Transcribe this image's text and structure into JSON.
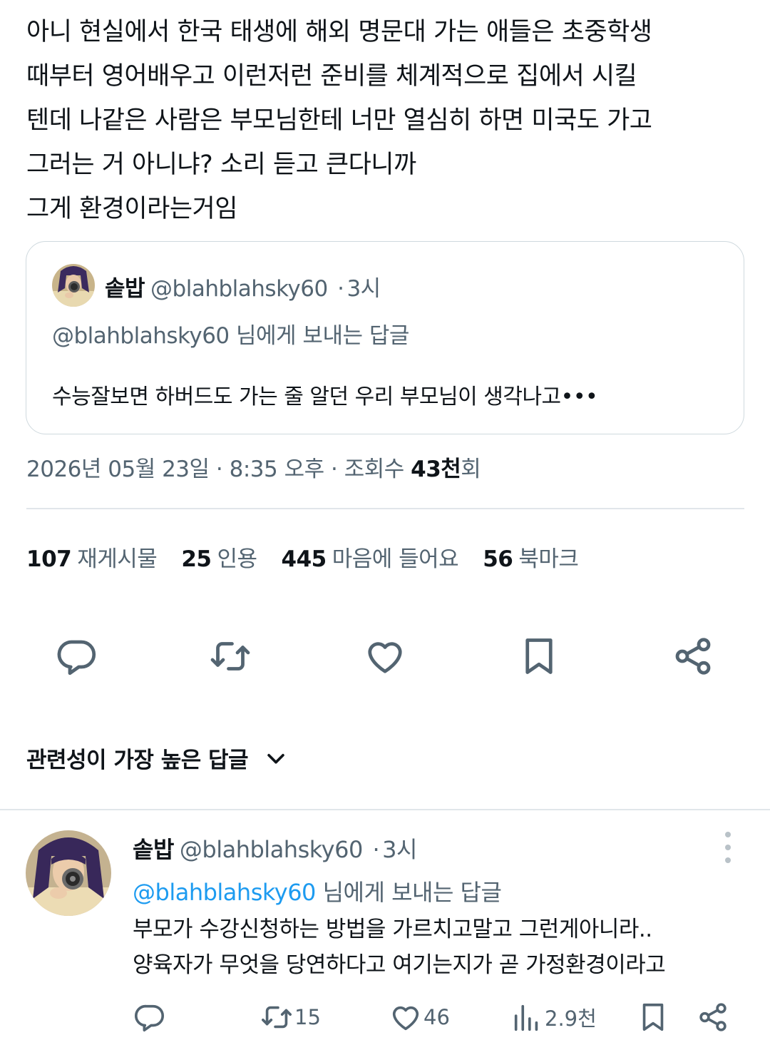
{
  "tweet": {
    "lines": [
      "아니 현실에서 한국 태생에 해외 명문대 가는 애들은 초중학생",
      "때부터 영어배우고 이런저런 준비를 체계적으로 집에서 시킬",
      "텐데 나같은 사람은 부모님한테 너만 열심히 하면 미국도 가고",
      "그러는 거 아니냐? 소리 듣고 큰다니까",
      "그게 환경이라는거임"
    ]
  },
  "quote": {
    "name": "솥밥",
    "handle": "@blahblahsky60",
    "dot": "·",
    "time": "3시",
    "reply_to": "@blahblahsky60 님에게 보내는 답글",
    "body": "수능잘보면 하버드도 가는 줄 알던 우리 부모님이 생각나고•••"
  },
  "meta": {
    "date": "2026년 05월 23일",
    "sep1": " · ",
    "time": "8:35 오후",
    "sep2": " · ",
    "views_label": "조회수 ",
    "views_num": "43천",
    "views_suffix": "회"
  },
  "stats": [
    {
      "num": "107",
      "label": "재게시물"
    },
    {
      "num": "25",
      "label": "인용"
    },
    {
      "num": "445",
      "label": "마음에 들어요"
    },
    {
      "num": "56",
      "label": "북마크"
    }
  ],
  "actions": {
    "icons": [
      "reply-icon",
      "retweet-icon",
      "like-icon",
      "bookmark-icon",
      "share-icon"
    ]
  },
  "sort": {
    "label": "관련성이 가장 높은 답글"
  },
  "reply": {
    "name": "솥밥",
    "handle": "@blahblahsky60",
    "dot": "·",
    "time": "3시",
    "reply_to_mention": "@blahblahsky60",
    "reply_to_suffix": " 님에게 보내는 답글",
    "body_lines": [
      "부모가 수강신청하는 방법을 가르치고말고 그런게아니라..",
      "양육자가 무엇을 당연하다고 여기는지가 곧 가정환경이라고"
    ],
    "retweets": "15",
    "likes": "46",
    "views": "2.9천"
  },
  "colors": {
    "text": "#0f1419",
    "secondary": "#536471",
    "accent": "#1d9bf0",
    "border": "#cfd9de"
  }
}
